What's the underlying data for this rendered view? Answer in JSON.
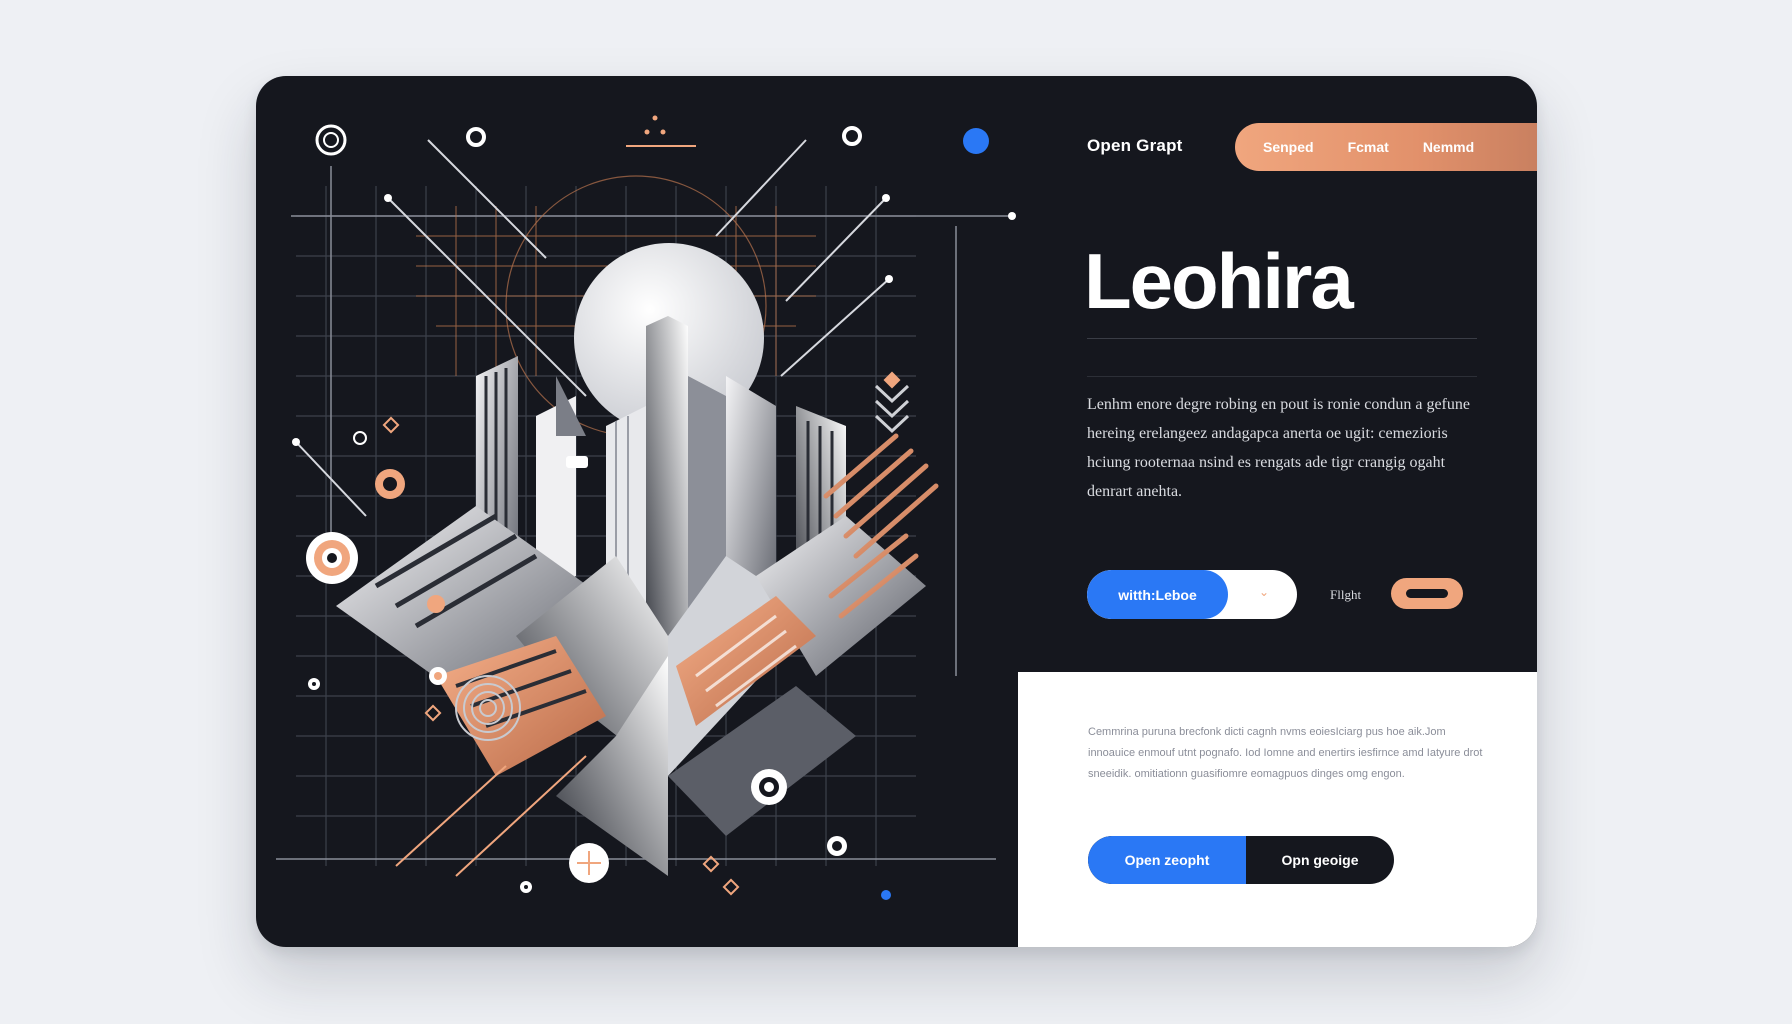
{
  "header": {
    "brand": "Open Grapt",
    "nav": [
      "Senped",
      "Fcmat",
      "Nemmd"
    ]
  },
  "hero": {
    "title": "Leohira",
    "description": "Lenhm enore degre robing en pout is ronie condun a gefune hereing erelangeez andagapca anerta oe ugit: cemezioris hciung rooternaa nsind es rengats ade tigr crangig ogaht denrart anehta."
  },
  "controls": {
    "primary_label": "witth:Leboe",
    "flag_label": "Fllght"
  },
  "panel": {
    "text": "Cemmrina puruna brecfonk dicti cagnh nvms eoiesIciarg pus hoe aik.Jom innoauice enmouf utnt pognafo. Iod Iomne and enertirs iesfirnce amd Iatyure drot sneeidik. omitiationn guasifiomre eomagpuos dinges omg engon.",
    "buttons": [
      "Open zeopht",
      "Opn geoige"
    ]
  },
  "colors": {
    "accent": "#2a78f5",
    "brand_orange": "#f0a67e",
    "dark": "#15171e"
  }
}
